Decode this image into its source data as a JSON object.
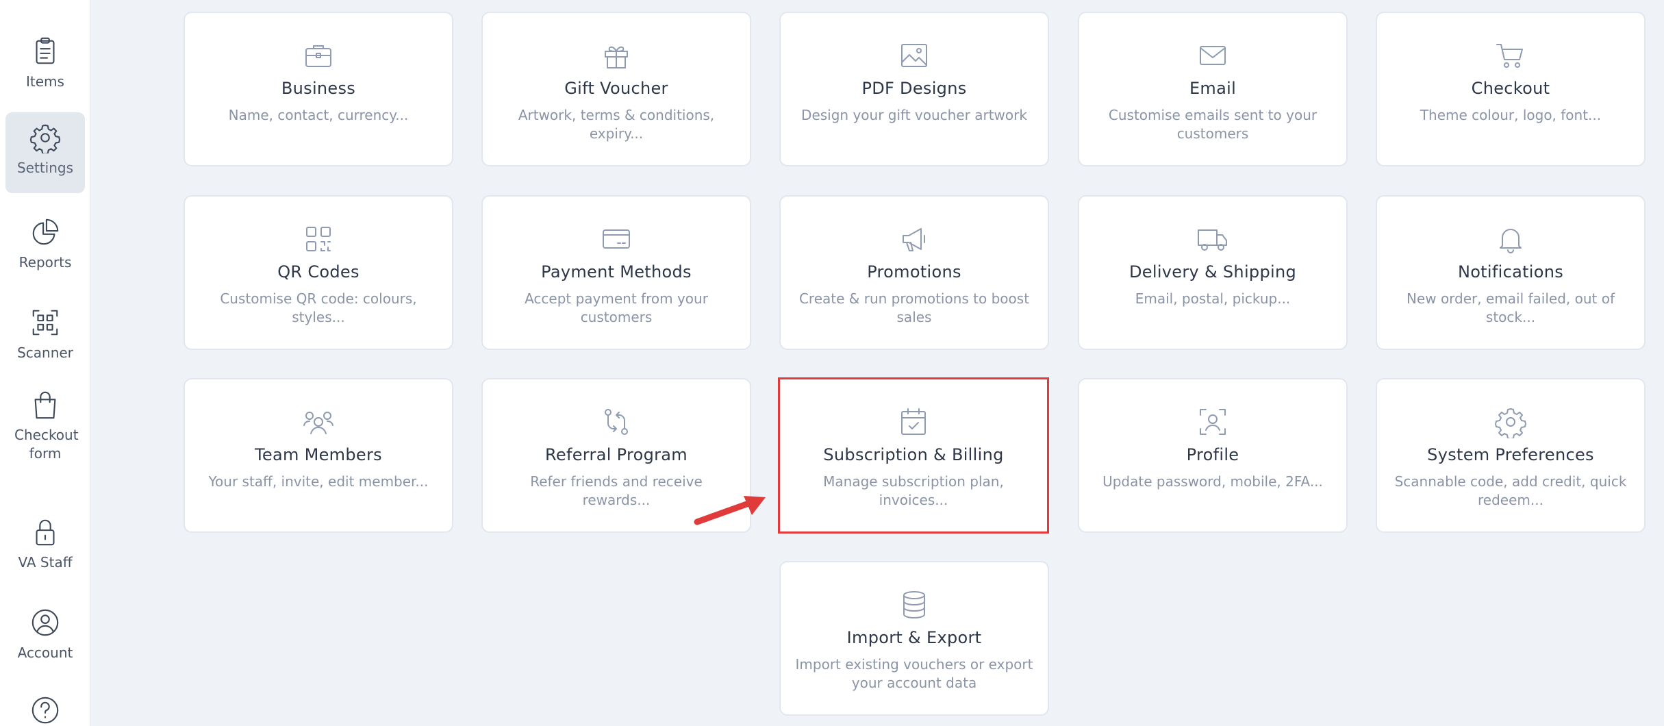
{
  "sidebar": {
    "items": [
      {
        "label": "Items",
        "icon": "clipboard-icon"
      },
      {
        "label": "Settings",
        "icon": "gear-icon",
        "active": true
      },
      {
        "label": "Reports",
        "icon": "pie-chart-icon"
      },
      {
        "label": "Scanner",
        "icon": "qr-scan-icon"
      },
      {
        "label": "Checkout form",
        "icon": "shopping-bag-icon"
      },
      {
        "label": "VA Staff",
        "icon": "lock-icon"
      },
      {
        "label": "Account",
        "icon": "user-circle-icon"
      },
      {
        "label": "",
        "icon": "help-icon"
      }
    ]
  },
  "cards": [
    {
      "title": "Business",
      "desc": "Name, contact, currency...",
      "icon": "briefcase-icon"
    },
    {
      "title": "Gift Voucher",
      "desc": "Artwork, terms & conditions, expiry...",
      "icon": "gift-icon"
    },
    {
      "title": "PDF Designs",
      "desc": "Design your gift voucher artwork",
      "icon": "image-icon"
    },
    {
      "title": "Email",
      "desc": "Customise emails sent to your customers",
      "icon": "envelope-icon"
    },
    {
      "title": "Checkout",
      "desc": "Theme colour, logo, font...",
      "icon": "cart-icon"
    },
    {
      "title": "QR Codes",
      "desc": "Customise QR code: colours, styles...",
      "icon": "qr-code-icon"
    },
    {
      "title": "Payment Methods",
      "desc": "Accept payment from your customers",
      "icon": "credit-card-icon"
    },
    {
      "title": "Promotions",
      "desc": "Create & run promotions to boost sales",
      "icon": "megaphone-icon"
    },
    {
      "title": "Delivery & Shipping",
      "desc": "Email, postal, pickup...",
      "icon": "truck-icon"
    },
    {
      "title": "Notifications",
      "desc": "New order, email failed, out of stock...",
      "icon": "bell-icon"
    },
    {
      "title": "Team Members",
      "desc": "Your staff, invite, edit member...",
      "icon": "users-icon"
    },
    {
      "title": "Referral Program",
      "desc": "Refer friends and receive rewards...",
      "icon": "referral-arrows-icon"
    },
    {
      "title": "Subscription & Billing",
      "desc": "Manage subscription plan, invoices...",
      "icon": "calendar-check-icon"
    },
    {
      "title": "Profile",
      "desc": "Update password, mobile, 2FA...",
      "icon": "user-scan-icon"
    },
    {
      "title": "System Preferences",
      "desc": "Scannable code, add credit, quick redeem...",
      "icon": "gear-icon"
    },
    {
      "title": "Import & Export",
      "desc": "Import existing vouchers or export your account data",
      "icon": "database-icon"
    }
  ],
  "colors": {
    "highlight_border": "#e03a3a",
    "arrow": "#e03a3a",
    "background": "#eff2f7",
    "card_icon": "#8f9bb0"
  }
}
